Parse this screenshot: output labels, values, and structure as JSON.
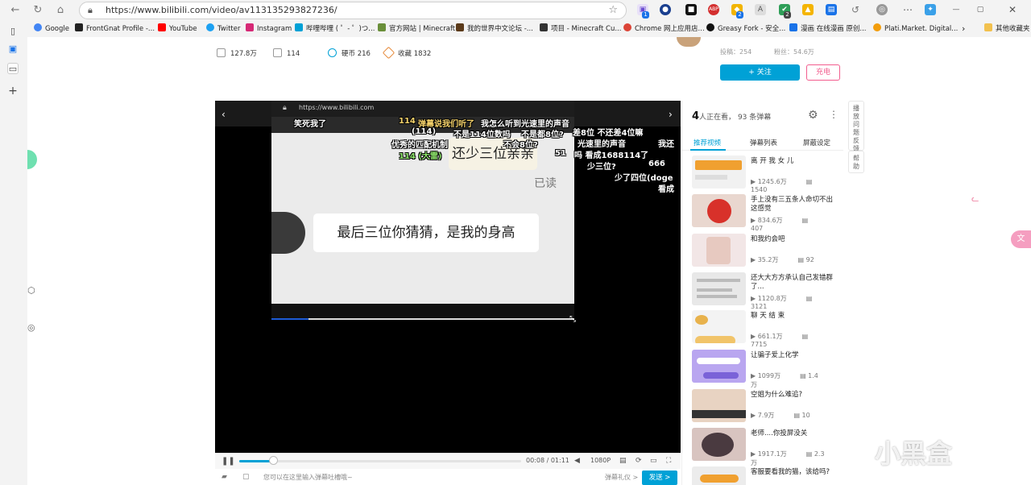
{
  "browser": {
    "url": "https://www.bilibili.com/video/av113135293827236/",
    "bookmarks": [
      {
        "label": "Google",
        "color": "#4285f4"
      },
      {
        "label": "FrontGnat Profile -...",
        "color": "#222222"
      },
      {
        "label": "YouTube",
        "color": "#ff0000"
      },
      {
        "label": "Twitter",
        "color": "#1da1f2"
      },
      {
        "label": "Instagram",
        "color": "#d62976"
      },
      {
        "label": "哔哩哔哩 ( ゜- ゜)つ...",
        "color": "#00a1d6"
      },
      {
        "label": "官方网站 | Minecraft",
        "color": "#6a8f3a"
      },
      {
        "label": "我的世界中文论坛 -...",
        "color": "#5b3a1a"
      },
      {
        "label": "项目 - Minecraft Cu...",
        "color": "#333333"
      },
      {
        "label": "Chrome 网上应用店...",
        "color": "#db4437"
      },
      {
        "label": "Greasy Fork - 安全...",
        "color": "#111111"
      },
      {
        "label": "漫画 在线漫画 原创...",
        "color": "#1a73e8"
      },
      {
        "label": "Plati.Market. Digital...",
        "color": "#f29d0c"
      }
    ],
    "bookmark_overflow": "›",
    "other_bookmarks": "其他收藏夹",
    "ext_badges": [
      "1",
      "2",
      "2"
    ]
  },
  "video_stats": {
    "views": "127.8万",
    "danmaku": "114",
    "coins_label": "硬币 216",
    "favorites_label": "收藏 1832"
  },
  "uploader": {
    "posts_label": "投稿：254",
    "fans_label": "粉丝：54.6万",
    "follow_label": "+ 关注",
    "charge_label": "充电"
  },
  "pip": {
    "url": "https://www.bilibili.com",
    "bubble_1": "还少三位亲亲",
    "read_mark": "已读",
    "bubble_2": "最后三位你猜猜，是我的身高"
  },
  "danmaku": [
    {
      "text": "笑死我了",
      "color": "#ffffff"
    },
    {
      "text": "114",
      "color": "#f6d36b"
    },
    {
      "text": "弹幕说我们听了",
      "color": "#f6d36b"
    },
    {
      "text": "我怎么听到光速里的声音",
      "color": "#ffffff"
    },
    {
      "text": "(114)",
      "color": "#ffffff"
    },
    {
      "text": "不是114位数吗",
      "color": "#ffffff"
    },
    {
      "text": "不是都8位?",
      "color": "#ffffff"
    },
    {
      "text": "差8位 不还差4位嘛",
      "color": "#ffffff"
    },
    {
      "text": "优秀的匹配机制",
      "color": "#ffffff"
    },
    {
      "text": "不会8位?",
      "color": "#ffffff"
    },
    {
      "text": "光速里的声音",
      "color": "#ffffff"
    },
    {
      "text": "我还",
      "color": "#ffffff"
    },
    {
      "text": "114 (大雷)",
      "color": "#8de36b"
    },
    {
      "text": "51",
      "color": "#ffffff"
    },
    {
      "text": "吗 看成1688114了",
      "color": "#ffffff"
    },
    {
      "text": "少三位?",
      "color": "#ffffff"
    },
    {
      "text": "666",
      "color": "#ffffff"
    },
    {
      "text": "少了四位(doge",
      "color": "#ffffff"
    },
    {
      "text": "看成",
      "color": "#ffffff"
    }
  ],
  "controls": {
    "progress": 0.12,
    "time": "00:08 / 01:11",
    "quality": "1080P"
  },
  "danmaku_input": {
    "placeholder": "您可以在这里输入弹幕吐槽哦~",
    "etiquette": "弹幕礼仪 >",
    "send": "发送 >"
  },
  "right_panel": {
    "watching_count": "4",
    "watching_label": "人正在看，",
    "danmaku_count_label": "93 条弹幕",
    "tabs": [
      "推荐视频",
      "弹幕列表",
      "屏蔽设定"
    ],
    "recommendations": [
      {
        "title": "离 开 我 女 儿",
        "views": "1245.6万",
        "danmaku": "1540",
        "thumb": "#f1f1f1",
        "accent": "#f0a030"
      },
      {
        "title": "手上没有三五条人命切不出这感觉",
        "views": "834.6万",
        "danmaku": "407",
        "thumb": "#e9d7cf",
        "accent": "#d8312a"
      },
      {
        "title": "和我约会吧",
        "views": "35.2万",
        "danmaku": "92",
        "thumb": "#f2e6e6",
        "accent": "#e7c9c0"
      },
      {
        "title": "还大大方方承认自己发错群了...",
        "views": "1120.8万",
        "danmaku": "3121",
        "thumb": "#e8e8e8",
        "accent": "#bbbbbb"
      },
      {
        "title": "聊 天 结 束",
        "views": "661.1万",
        "danmaku": "7715",
        "thumb": "#f3f3f3",
        "accent": "#e8b24c"
      },
      {
        "title": "让骗子爱上化学",
        "views": "1099万",
        "danmaku": "1.4万",
        "thumb": "#b9a6f0",
        "accent": "#7a62d8"
      },
      {
        "title": "空姐为什么难追?",
        "views": "7.9万",
        "danmaku": "10",
        "thumb": "#e8d3c2",
        "accent": "#8a6b55"
      },
      {
        "title": "老师....你投屏没关",
        "views": "1917.1万",
        "danmaku": "2.3万",
        "thumb": "#d8c4c0",
        "accent": "#4a3a40"
      },
      {
        "title": "客服要看我的猫，该给吗?",
        "views": "",
        "danmaku": "",
        "thumb": "#ececec",
        "accent": "#f0a030"
      }
    ]
  },
  "side_buttons": [
    "播放问题反馈",
    "帮助"
  ],
  "watermark": "小黑盒",
  "colors": {
    "bilibili_blue": "#00a1d6",
    "pink": "#f25d8e"
  }
}
